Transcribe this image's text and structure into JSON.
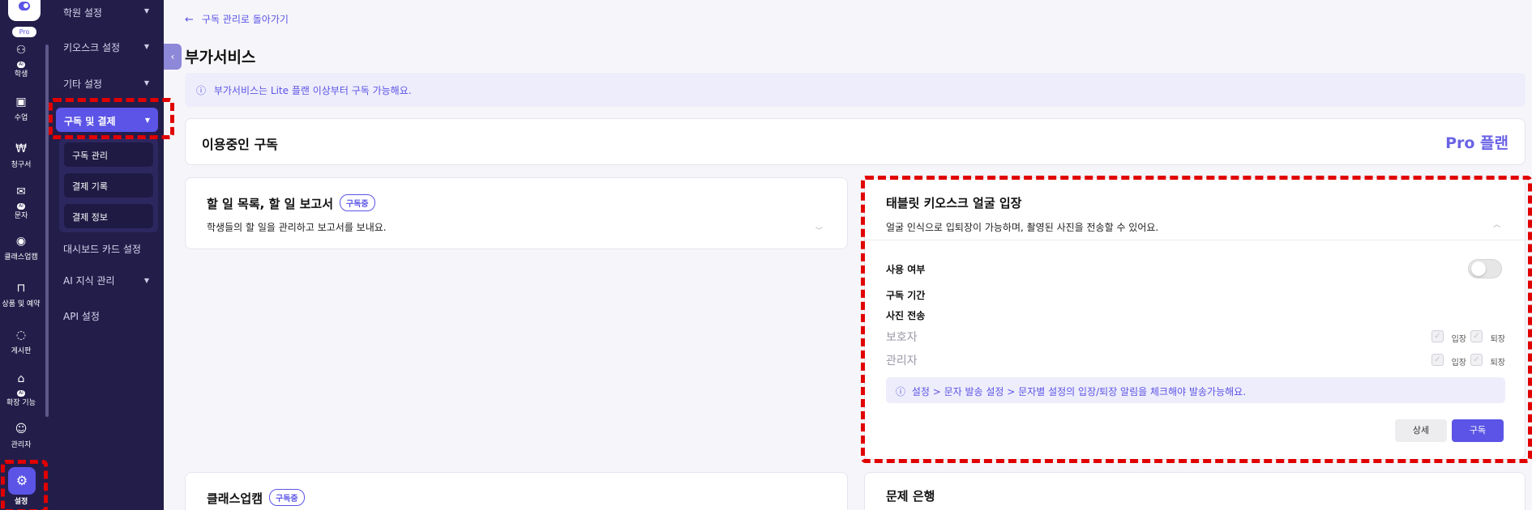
{
  "rail": {
    "pro_badge": "Pro",
    "ai_tag": "AI",
    "items": [
      {
        "label": "학생",
        "icon": "users-icon"
      },
      {
        "label": "수업",
        "icon": "calendar-icon"
      },
      {
        "label": "청구서",
        "icon": "won-icon"
      },
      {
        "label": "문자",
        "icon": "message-icon"
      },
      {
        "label": "클래스업캠",
        "icon": "webcam-icon"
      },
      {
        "label": "상품 및 예약",
        "icon": "bag-icon"
      },
      {
        "label": "게시판",
        "icon": "board-icon"
      },
      {
        "label": "확장 기능",
        "icon": "extension-icon"
      },
      {
        "label": "관리자",
        "icon": "admin-icon"
      },
      {
        "label": "설정",
        "icon": "gear-icon"
      }
    ]
  },
  "sidebar": {
    "items": [
      "학원 설정",
      "키오스크 설정",
      "기타 설정"
    ],
    "active": "구독 및 결제",
    "sub_items": [
      "구독 관리",
      "결제 기록",
      "결제 정보"
    ],
    "more_items": [
      "대시보드 카드 설정",
      "AI 지식 관리",
      "API 설정"
    ]
  },
  "header": {
    "back": "구독 관리로 돌아가기",
    "title": "부가서비스",
    "notice": "부가서비스는 Lite 플랜 이상부터 구독 가능해요."
  },
  "subscription": {
    "label": "이용중인 구독",
    "plan": "Pro 플랜"
  },
  "services": {
    "todo": {
      "name": "할 일 목록, 할 일 보고서",
      "badge": "구독중",
      "desc": "학생들의 할 일을 관리하고 보고서를 보내요."
    },
    "kiosk": {
      "name": "태블릿 키오스크 얼굴 입장",
      "desc": "얼굴 인식으로 입퇴장이 가능하며, 촬영된 사진을 전송할 수 있어요.",
      "usage_label": "사용 여부",
      "usage_on": false,
      "period_label": "구독 기간",
      "photo_label": "사진 전송",
      "roles": [
        "보호자",
        "관리자"
      ],
      "enter_label": "입장",
      "exit_label": "퇴장",
      "info": "설정 > 문자 발송 설정 > 문자별 설정의 입장/퇴장 알림을 체크해야 발송가능해요.",
      "detail_button": "상세",
      "subscribe_button": "구독"
    },
    "classupcam": {
      "name": "클래스업캠",
      "badge": "구독중"
    },
    "question_bank": {
      "name": "문제 은행"
    }
  },
  "colors": {
    "accent": "#5b54e6",
    "sidebar_bg": "#231d4a",
    "highlight": "#e10000"
  }
}
